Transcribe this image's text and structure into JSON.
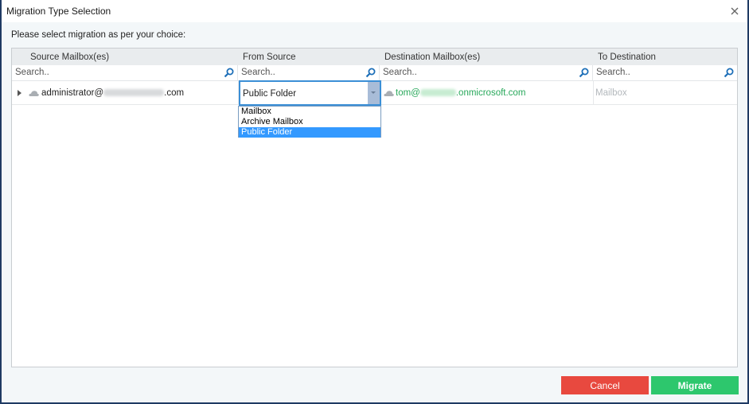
{
  "window": {
    "title": "Migration Type Selection",
    "close_icon": "close-icon"
  },
  "instruction": "Please select migration as per your choice:",
  "grid": {
    "columns": [
      {
        "label": "Source Mailbox(es)"
      },
      {
        "label": "From Source"
      },
      {
        "label": "Destination Mailbox(es)"
      },
      {
        "label": "To Destination"
      }
    ],
    "search_placeholder": "Search..",
    "rows": [
      {
        "source_prefix": "administrator@",
        "source_suffix": ".com",
        "from_source": "Public Folder",
        "destination_prefix": "tom@",
        "destination_suffix": ".onmicrosoft.com",
        "to_destination": "Mailbox"
      }
    ]
  },
  "dropdown": {
    "options": [
      "Mailbox",
      "Archive Mailbox",
      "Public Folder"
    ],
    "selected": "Public Folder"
  },
  "buttons": {
    "cancel": "Cancel",
    "migrate": "Migrate"
  },
  "colors": {
    "cancel": "#e8493f",
    "migrate": "#2dc76d",
    "destination_text": "#27a85a",
    "selection": "#3399ff"
  }
}
